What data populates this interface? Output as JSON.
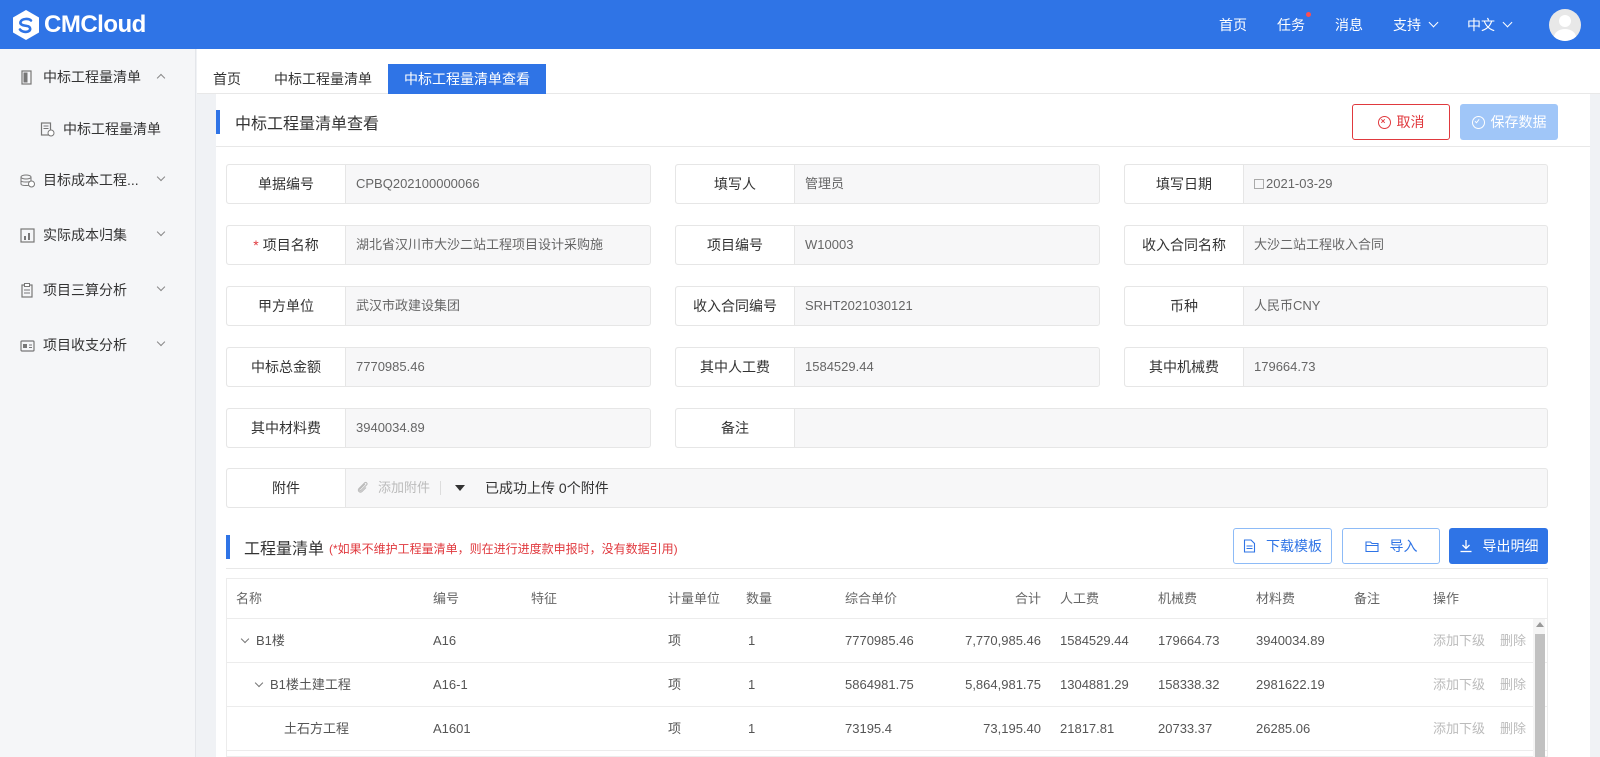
{
  "brand": {
    "logo_text": "CMCloud",
    "logo_icon": "cmcloud-logo-icon"
  },
  "colors": {
    "primary": "#2f74e6",
    "danger": "#e0393e",
    "disabled": "#a0c6f8"
  },
  "topnav": {
    "home": "首页",
    "tasks": "任务",
    "messages": "消息",
    "support": "支持",
    "language": "中文",
    "avatar_icon": "user-avatar-icon"
  },
  "sidebar": {
    "items": [
      {
        "label": "中标工程量清单",
        "icon": "document-icon",
        "expanded": true
      },
      {
        "label": "中标工程量清单",
        "icon": "list-document-icon",
        "sub": true
      },
      {
        "label": "目标成本工程...",
        "icon": "coins-icon"
      },
      {
        "label": "实际成本归集",
        "icon": "chart-box-icon"
      },
      {
        "label": "项目三算分析",
        "icon": "clipboard-icon"
      },
      {
        "label": "项目收支分析",
        "icon": "wallet-icon"
      }
    ]
  },
  "tabs": [
    "首页",
    "中标工程量清单",
    "中标工程量清单查看"
  ],
  "page": {
    "title": "中标工程量清单查看",
    "cancel_label": "取消",
    "save_label": "保存数据"
  },
  "form": {
    "doc_no": {
      "label": "单据编号",
      "value": "CPBQ202100000066"
    },
    "writer": {
      "label": "填写人",
      "value": "管理员"
    },
    "date": {
      "label": "填写日期",
      "value": "2021-03-29"
    },
    "project_name": {
      "label": "项目名称",
      "value": "湖北省汉川市大沙二站工程项目设计采购施"
    },
    "project_no": {
      "label": "项目编号",
      "value": "W10003"
    },
    "contract_name": {
      "label": "收入合同名称",
      "value": "大沙二站工程收入合同"
    },
    "party_a": {
      "label": "甲方单位",
      "value": "武汉市政建设集团"
    },
    "contract_no": {
      "label": "收入合同编号",
      "value": "SRHT2021030121"
    },
    "currency": {
      "label": "币种",
      "value": "人民币CNY"
    },
    "total": {
      "label": "中标总金额",
      "value": "7770985.46"
    },
    "labor": {
      "label": "其中人工费",
      "value": "1584529.44"
    },
    "machine": {
      "label": "其中机械费",
      "value": "179664.73"
    },
    "material": {
      "label": "其中材料费",
      "value": "3940034.89"
    },
    "remark": {
      "label": "备注",
      "value": ""
    },
    "attachment": {
      "label": "附件",
      "add_label": "添加附件",
      "status": "已成功上传 0个附件"
    }
  },
  "bill": {
    "title": "工程量清单",
    "note": "(*如果不维护工程量清单，则在进行进度款申报时，没有数据引用)",
    "download_label": "下载模板",
    "import_label": "导入",
    "export_label": "导出明细",
    "columns": [
      "名称",
      "编号",
      "特征",
      "计量单位",
      "数量",
      "综合单价",
      "合计",
      "人工费",
      "机械费",
      "材料费",
      "备注",
      "操作"
    ],
    "rows": [
      {
        "name": "B1楼",
        "code": "A16",
        "feature": "",
        "unit": "项",
        "qty": "1",
        "price": "7770985.46",
        "sum": "7,770,985.46",
        "labor": "1584529.44",
        "machine": "179664.73",
        "material": "3940034.89",
        "remark": "",
        "op1": "添加下级",
        "op2": "删除"
      },
      {
        "name": "B1楼土建工程",
        "code": "A16-1",
        "feature": "",
        "unit": "项",
        "qty": "1",
        "price": "5864981.75",
        "sum": "5,864,981.75",
        "labor": "1304881.29",
        "machine": "158338.32",
        "material": "2981622.19",
        "remark": "",
        "op1": "添加下级",
        "op2": "删除"
      },
      {
        "name": "土石方工程",
        "code": "A1601",
        "feature": "",
        "unit": "项",
        "qty": "1",
        "price": "73195.4",
        "sum": "73,195.40",
        "labor": "21817.81",
        "machine": "20733.37",
        "material": "26285.06",
        "remark": "",
        "op1": "添加下级",
        "op2": "删除"
      }
    ]
  }
}
